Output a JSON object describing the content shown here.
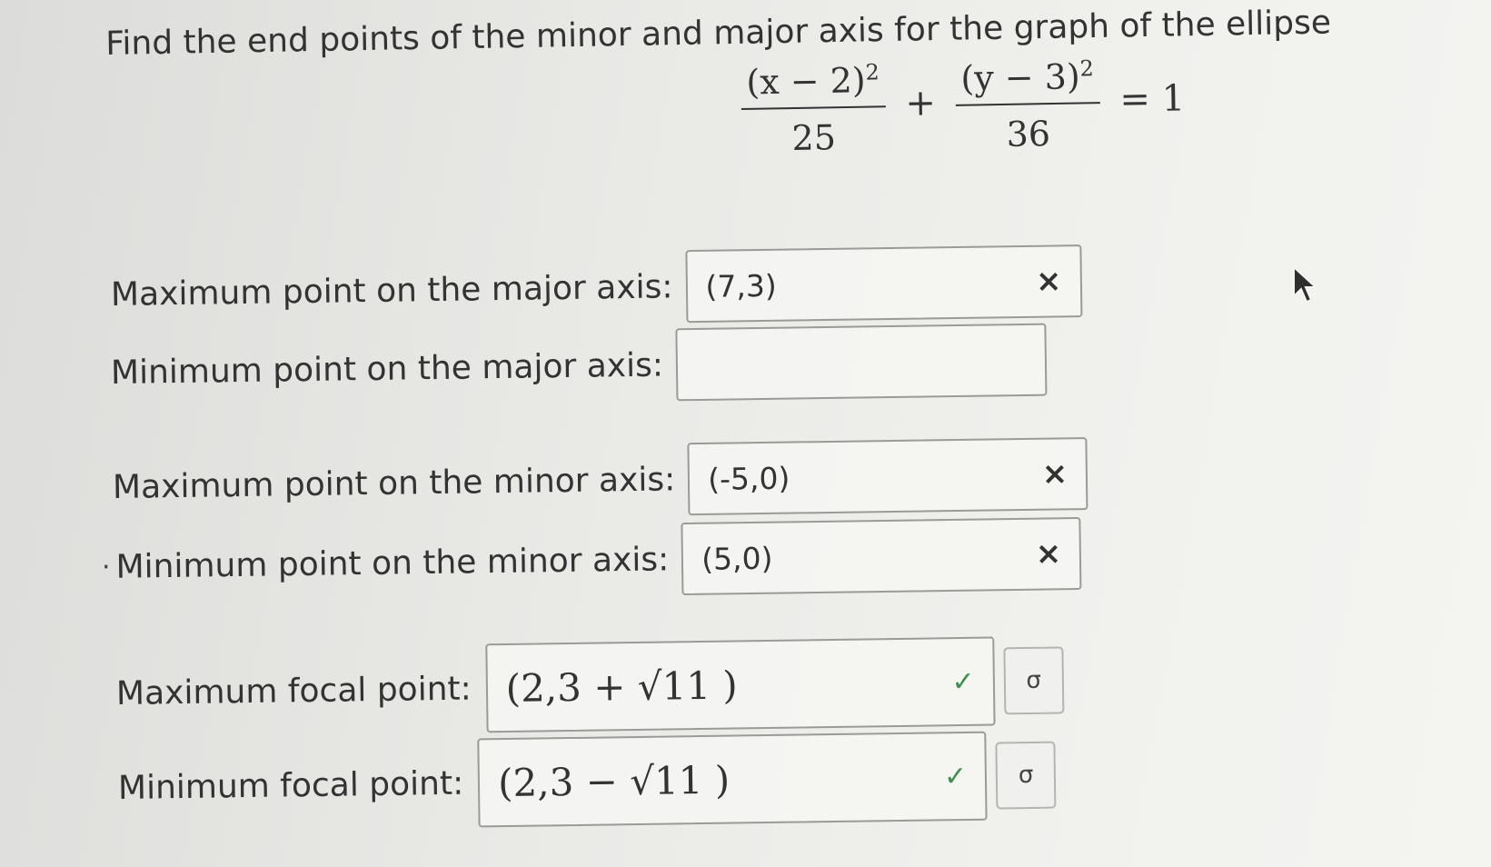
{
  "question": "Find the end points of the minor and major axis for the graph of the ellipse",
  "equation": {
    "term1_num": "(x − 2)",
    "term1_exp": "2",
    "term1_den": "25",
    "plus": "+",
    "term2_num": "(y − 3)",
    "term2_exp": "2",
    "term2_den": "36",
    "equals": "= 1"
  },
  "fields": [
    {
      "label": "Maximum point on the major axis:",
      "value": "(7,3)",
      "status": "incorrect",
      "status_icon": "×"
    },
    {
      "label": "Minimum point on the major axis:",
      "value": "",
      "status": "empty"
    },
    {
      "label": "Maximum point on the minor axis:",
      "value": "(-5,0)",
      "status": "incorrect",
      "status_icon": "×"
    },
    {
      "label": "Minimum point on the minor axis:",
      "value": "(5,0)",
      "status": "incorrect",
      "status_icon": "×"
    },
    {
      "label": "Maximum focal point:",
      "value": "(2,3 + √11 )",
      "status": "correct",
      "status_icon": "✓",
      "key_icon": "σ"
    },
    {
      "label": "Minimum focal point:",
      "value": "(2,3 − √11 )",
      "status": "correct",
      "status_icon": "✓",
      "key_icon": "σ"
    }
  ],
  "colors": {
    "correct": "#3f8f4f",
    "incorrect": "#333333"
  },
  "icons": {
    "cursor": "mouse-pointer-icon",
    "key": "answer-key-icon"
  }
}
